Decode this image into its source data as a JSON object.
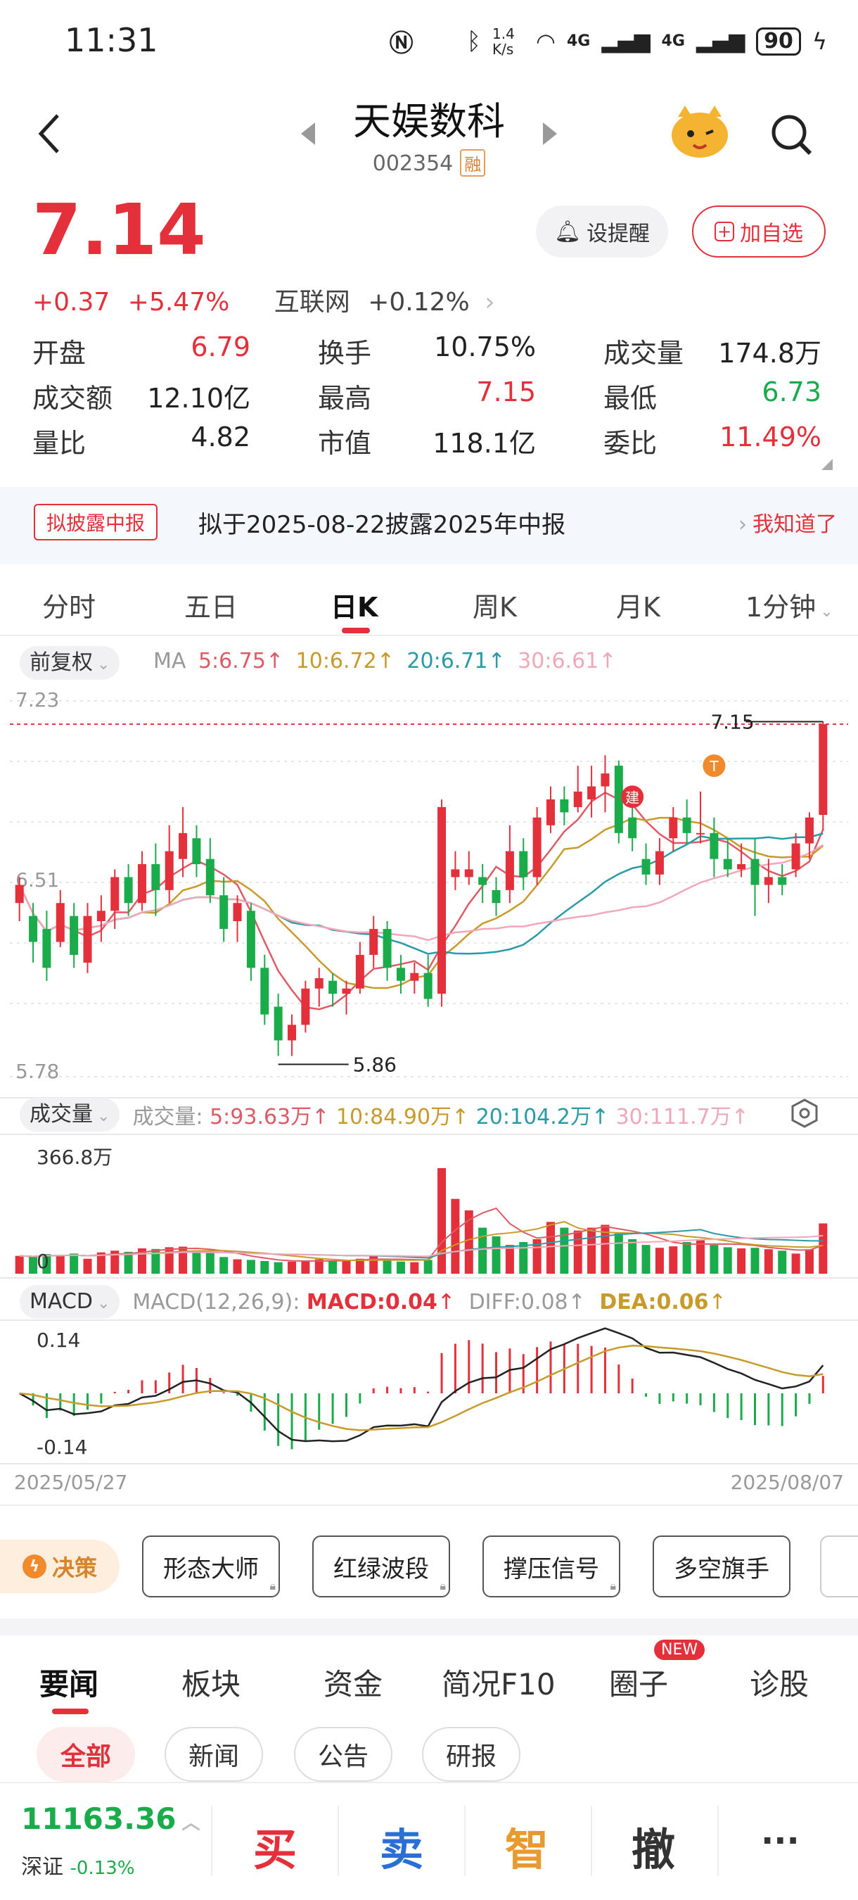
{
  "status_bar": {
    "time": "11:31",
    "net_speed": "1.4 K/s",
    "signal1": "4G",
    "signal2": "4G",
    "battery": "90"
  },
  "header": {
    "stock_name": "天娱数科",
    "stock_code": "002354",
    "margin_tag": "融"
  },
  "quote": {
    "price": "7.14",
    "change": "+0.37",
    "change_pct": "+5.47%",
    "industry": "互联网",
    "industry_change": "+0.12%",
    "set_alert_label": "设提醒",
    "add_watch_label": "加自选"
  },
  "stats": [
    [
      {
        "label": "开盘",
        "value": "6.79",
        "color": "#e4303a"
      },
      {
        "label": "换手",
        "value": "10.75%",
        "color": "#222222"
      },
      {
        "label": "成交量",
        "value": "174.8万",
        "color": "#222222"
      }
    ],
    [
      {
        "label": "成交额",
        "value": "12.10亿",
        "color": "#222222"
      },
      {
        "label": "最高",
        "value": "7.15",
        "color": "#e4303a"
      },
      {
        "label": "最低",
        "value": "6.73",
        "color": "#1aab4b"
      }
    ],
    [
      {
        "label": "量比",
        "value": "4.82",
        "color": "#222222"
      },
      {
        "label": "市值",
        "value": "118.1亿",
        "color": "#222222"
      },
      {
        "label": "委比",
        "value": "11.49%",
        "color": "#e4303a"
      }
    ]
  ],
  "notice": {
    "tag": "拟披露中报",
    "text": "拟于2025-08-22披露2025年中报",
    "ack": "我知道了"
  },
  "period_tabs": [
    "分时",
    "五日",
    "日K",
    "周K",
    "月K",
    "1分钟"
  ],
  "active_period": "日K",
  "kline": {
    "adjust": "前复权",
    "ma_label": "MA",
    "ma": [
      {
        "text": "5:6.75",
        "color": "#e05a66"
      },
      {
        "text": "10:6.72",
        "color": "#c79a2a"
      },
      {
        "text": "20:6.71",
        "color": "#2a9aa6"
      },
      {
        "text": "30:6.61",
        "color": "#f0a8b8"
      }
    ],
    "y_top": "7.23",
    "y_mid": "6.51",
    "y_bottom": "5.78",
    "high_marker": "7.15",
    "low_marker": "5.86",
    "badge_jian": "建",
    "badge_t": "T"
  },
  "volume": {
    "label": "成交量",
    "legend_prefix": "成交量:",
    "ma": [
      {
        "text": "5:93.63万",
        "color": "#e05a66"
      },
      {
        "text": "10:84.90万",
        "color": "#c79a2a"
      },
      {
        "text": "20:104.2万",
        "color": "#2a9aa6"
      },
      {
        "text": "30:111.7万",
        "color": "#f0a8b8"
      }
    ],
    "max_label": "366.8万",
    "zero_label": "0"
  },
  "macd": {
    "label": "MACD",
    "params": "MACD(12,26,9):",
    "macd": "MACD:0.04",
    "diff": "DIFF:0.08",
    "dea": "DEA:0.06",
    "top": "0.14",
    "bottom": "-0.14"
  },
  "dates": {
    "start": "2025/05/27",
    "end": "2025/08/07"
  },
  "tools": {
    "decision": "决策",
    "items": [
      "形态大师",
      "红绿波段",
      "撑压信号",
      "多空旗手"
    ]
  },
  "news_tabs": [
    "要闻",
    "板块",
    "资金",
    "简况F10",
    "圈子",
    "诊股"
  ],
  "new_badge": "NEW",
  "news_chips": [
    "全部",
    "新闻",
    "公告",
    "研报"
  ],
  "bottom": {
    "index_value": "11163.36",
    "index_name": "深证",
    "index_change": "-0.13%",
    "buy": "买",
    "sell": "卖",
    "smart": "智",
    "cancel": "撤",
    "more": "···"
  },
  "chart_data": [
    {
      "type": "candlestick",
      "title": "",
      "ylim": [
        5.78,
        7.23
      ],
      "candles": [
        [
          6.45,
          6.52,
          6.38,
          6.55
        ],
        [
          6.4,
          6.3,
          6.22,
          6.45
        ],
        [
          6.35,
          6.2,
          6.15,
          6.42
        ],
        [
          6.3,
          6.45,
          6.28,
          6.5
        ],
        [
          6.4,
          6.25,
          6.2,
          6.45
        ],
        [
          6.22,
          6.4,
          6.18,
          6.45
        ],
        [
          6.38,
          6.42,
          6.3,
          6.48
        ],
        [
          6.42,
          6.55,
          6.35,
          6.58
        ],
        [
          6.55,
          6.45,
          6.4,
          6.6
        ],
        [
          6.45,
          6.6,
          6.42,
          6.65
        ],
        [
          6.6,
          6.5,
          6.4,
          6.68
        ],
        [
          6.5,
          6.65,
          6.45,
          6.75
        ],
        [
          6.62,
          6.72,
          6.55,
          6.82
        ],
        [
          6.7,
          6.6,
          6.55,
          6.75
        ],
        [
          6.62,
          6.48,
          6.45,
          6.7
        ],
        [
          6.48,
          6.35,
          6.3,
          6.55
        ],
        [
          6.38,
          6.45,
          6.3,
          6.48
        ],
        [
          6.42,
          6.2,
          6.15,
          6.45
        ],
        [
          6.2,
          6.02,
          5.98,
          6.25
        ],
        [
          6.05,
          5.92,
          5.86,
          6.1
        ],
        [
          5.92,
          5.98,
          5.86,
          6.02
        ],
        [
          5.98,
          6.12,
          5.95,
          6.15
        ],
        [
          6.12,
          6.16,
          6.05,
          6.2
        ],
        [
          6.15,
          6.1,
          6.05,
          6.18
        ],
        [
          6.1,
          6.12,
          6.02,
          6.15
        ],
        [
          6.12,
          6.25,
          6.1,
          6.3
        ],
        [
          6.25,
          6.35,
          6.2,
          6.4
        ],
        [
          6.35,
          6.2,
          6.15,
          6.38
        ],
        [
          6.2,
          6.15,
          6.1,
          6.25
        ],
        [
          6.15,
          6.18,
          6.1,
          6.22
        ],
        [
          6.18,
          6.08,
          6.05,
          6.25
        ],
        [
          6.1,
          6.82,
          6.05,
          6.85
        ],
        [
          6.55,
          6.58,
          6.5,
          6.65
        ],
        [
          6.55,
          6.58,
          6.52,
          6.65
        ],
        [
          6.55,
          6.52,
          6.45,
          6.6
        ],
        [
          6.5,
          6.45,
          6.4,
          6.55
        ],
        [
          6.5,
          6.65,
          6.45,
          6.75
        ],
        [
          6.65,
          6.55,
          6.5,
          6.7
        ],
        [
          6.55,
          6.78,
          6.52,
          6.82
        ],
        [
          6.75,
          6.85,
          6.72,
          6.9
        ],
        [
          6.85,
          6.8,
          6.75,
          6.9
        ],
        [
          6.82,
          6.88,
          6.8,
          6.98
        ],
        [
          6.85,
          6.9,
          6.78,
          6.98
        ],
        [
          6.9,
          6.95,
          6.8,
          7.02
        ],
        [
          6.98,
          6.72,
          6.68,
          7.0
        ],
        [
          6.78,
          6.7,
          6.65,
          6.82
        ],
        [
          6.62,
          6.56,
          6.52,
          6.68
        ],
        [
          6.56,
          6.65,
          6.52,
          6.7
        ],
        [
          6.7,
          6.78,
          6.65,
          6.82
        ],
        [
          6.78,
          6.72,
          6.68,
          6.85
        ],
        [
          6.72,
          6.72,
          6.68,
          6.88
        ],
        [
          6.72,
          6.62,
          6.55,
          6.78
        ],
        [
          6.62,
          6.58,
          6.55,
          6.7
        ],
        [
          6.58,
          6.6,
          6.55,
          6.68
        ],
        [
          6.62,
          6.52,
          6.4,
          6.7
        ],
        [
          6.52,
          6.55,
          6.45,
          6.62
        ],
        [
          6.55,
          6.52,
          6.48,
          6.6
        ],
        [
          6.58,
          6.68,
          6.55,
          6.72
        ],
        [
          6.68,
          6.78,
          6.62,
          6.8
        ],
        [
          6.79,
          7.14,
          6.73,
          7.15
        ]
      ],
      "volume": [
        62,
        58,
        68,
        64,
        70,
        52,
        74,
        80,
        76,
        88,
        86,
        92,
        94,
        80,
        72,
        58,
        50,
        48,
        44,
        40,
        42,
        46,
        50,
        44,
        46,
        52,
        60,
        50,
        42,
        40,
        48,
        366.8,
        260,
        220,
        160,
        130,
        100,
        110,
        120,
        180,
        160,
        150,
        160,
        170,
        140,
        120,
        100,
        90,
        95,
        110,
        120,
        100,
        92,
        88,
        90,
        85,
        80,
        70,
        85,
        174.8
      ]
    }
  ]
}
